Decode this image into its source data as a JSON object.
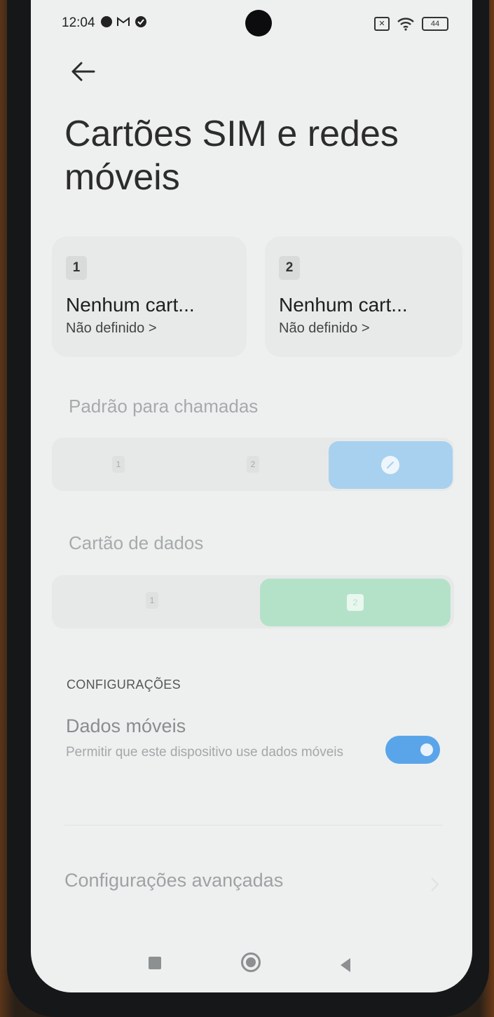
{
  "status": {
    "time": "12:04",
    "battery": "44",
    "icons": [
      "data-saver-icon",
      "gmail-icon",
      "check-circle-icon",
      "no-sim-icon",
      "wifi-icon",
      "battery-icon"
    ]
  },
  "header": {
    "back_icon": "arrow-left-icon",
    "title": "Cartões SIM e redes móveis"
  },
  "sims": [
    {
      "slot": "1",
      "name": "Nenhum cart...",
      "status": "Não definido >"
    },
    {
      "slot": "2",
      "name": "Nenhum cart...",
      "status": "Não definido >"
    }
  ],
  "calls": {
    "label": "Padrão para chamadas",
    "options": [
      "1",
      "2"
    ],
    "selected_icon": "ask-every-time-icon"
  },
  "data_card": {
    "label": "Cartão de dados",
    "options": [
      "1",
      "2"
    ],
    "selected": "2"
  },
  "settings": {
    "section_label": "CONFIGURAÇÕES",
    "mobile_data": {
      "title": "Dados móveis",
      "subtitle": "Permitir que este dispositivo use dados móveis",
      "enabled": true
    },
    "advanced": "Configurações avançadas"
  },
  "colors": {
    "calls_selected": "#a8d1ef",
    "data_selected": "#b3e2c9",
    "toggle_on": "#5aa5ea",
    "background": "#eef0f0"
  }
}
